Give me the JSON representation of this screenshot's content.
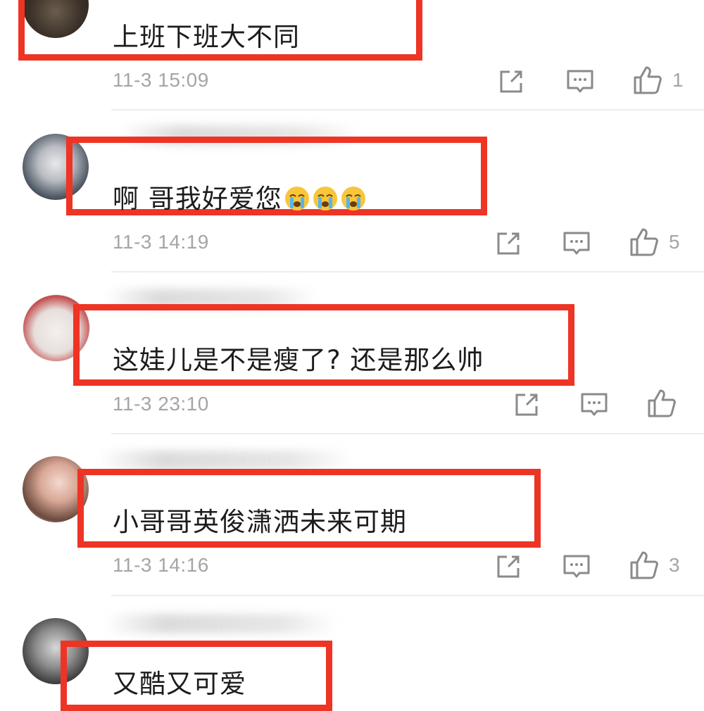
{
  "comments": [
    {
      "text": "上班下班大不同",
      "timestamp": "11-3 15:09",
      "likes": "1",
      "emoji_count": 0
    },
    {
      "text": "啊 哥我好爱您",
      "timestamp": "11-3 14:19",
      "likes": "5",
      "emoji": "crying-face",
      "emoji_count": 3
    },
    {
      "text": "这娃儿是不是瘦了? 还是那么帅",
      "timestamp": "11-3 23:10",
      "likes": "",
      "emoji_count": 0
    },
    {
      "text": "小哥哥英俊潇洒未来可期",
      "timestamp": "11-3 14:16",
      "likes": "3",
      "emoji_count": 0
    },
    {
      "text": "又酷又可爱",
      "timestamp": "",
      "likes": "",
      "emoji_count": 0
    }
  ],
  "icons": {
    "share": "share-icon",
    "reply": "comment-icon",
    "like": "thumbs-up-icon"
  },
  "colors": {
    "highlight": "#ee3424",
    "meta_text": "#a5a5a5",
    "body_text": "#1c1c1c"
  }
}
